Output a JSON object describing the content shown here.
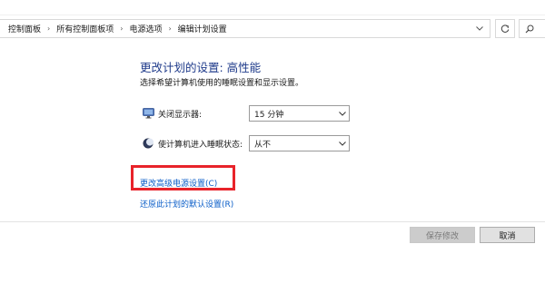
{
  "breadcrumb": {
    "items": [
      "控制面板",
      "所有控制面板项",
      "电源选项",
      "编辑计划设置"
    ],
    "separator": "›"
  },
  "address_bar": {
    "dropdown_icon": "chevron-down-icon",
    "refresh_icon": "refresh-icon",
    "search_icon": "search-icon"
  },
  "page": {
    "title": "更改计划的设置: 高性能",
    "subtitle": "选择希望计算机使用的睡眠设置和显示设置。"
  },
  "settings": {
    "display_off": {
      "label": "关闭显示器:",
      "value": "15 分钟",
      "icon": "monitor-icon"
    },
    "sleep": {
      "label": "使计算机进入睡眠状态:",
      "value": "从不",
      "icon": "moon-icon"
    }
  },
  "links": {
    "advanced": "更改高级电源设置(C)",
    "restore": "还原此计划的默认设置(R)"
  },
  "buttons": {
    "save": "保存修改",
    "cancel": "取消"
  },
  "colors": {
    "heading": "#1e3a8a",
    "link": "#0b5ec8",
    "highlight": "#e8232a"
  }
}
